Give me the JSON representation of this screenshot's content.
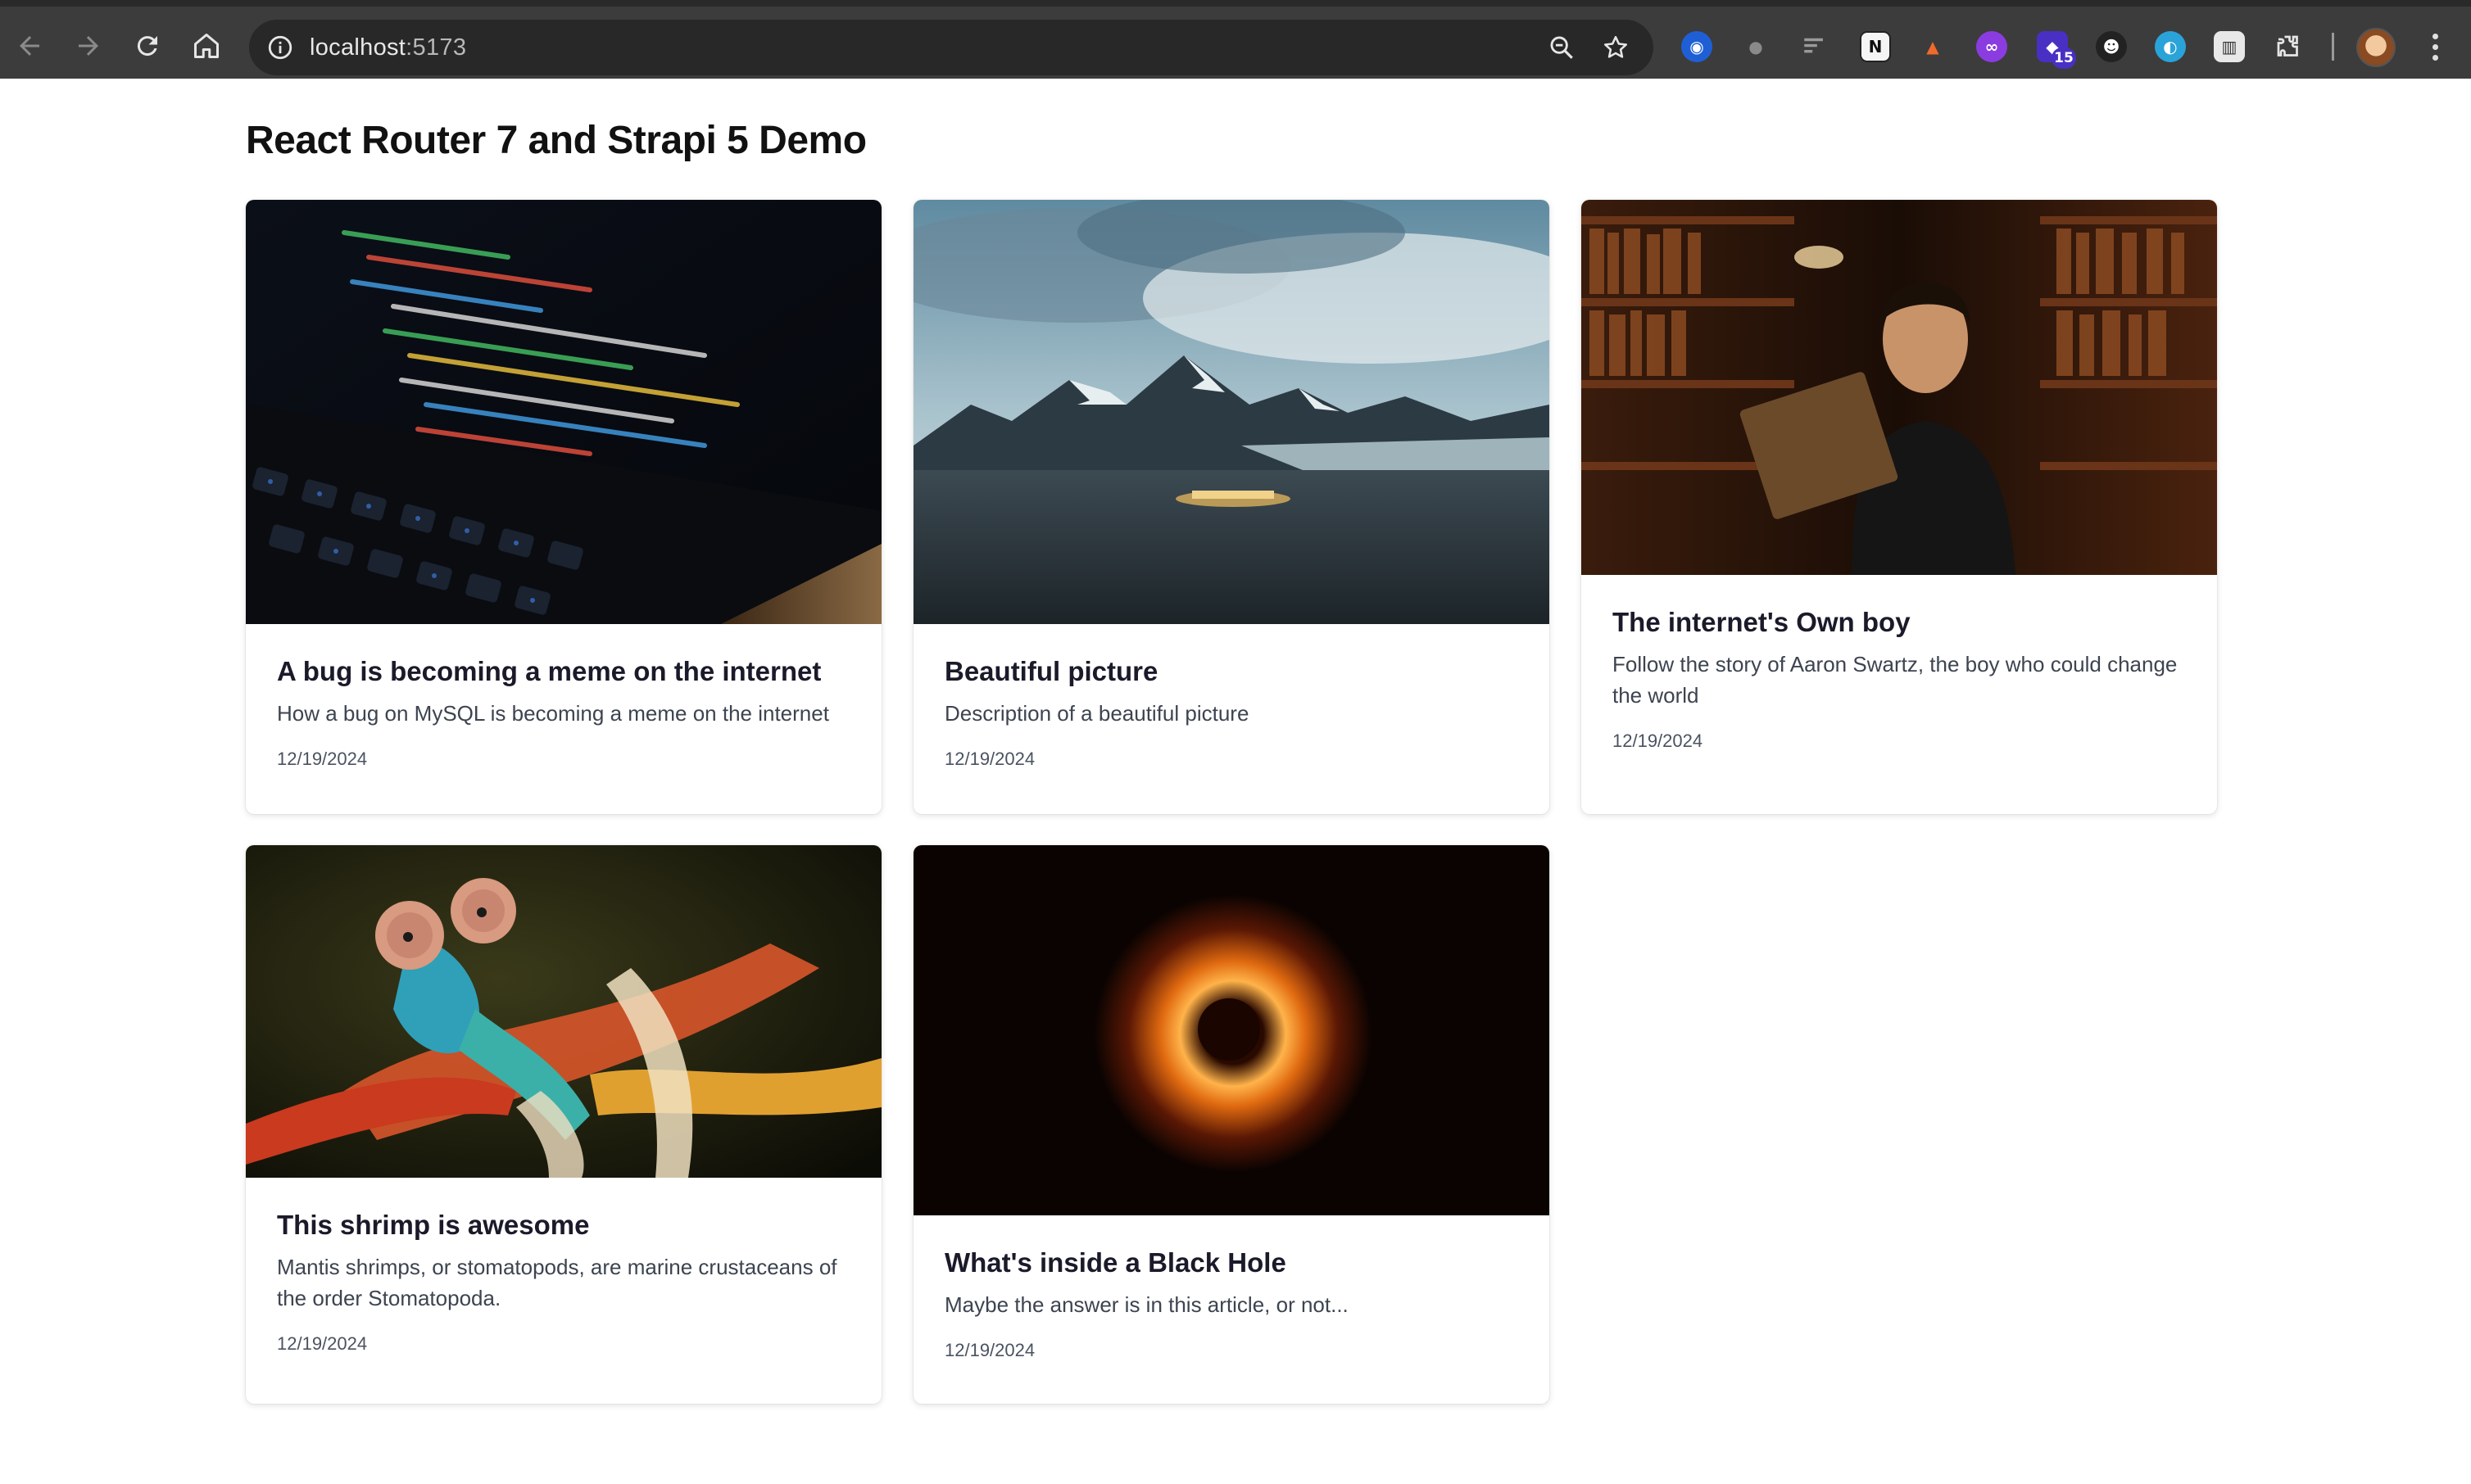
{
  "browser": {
    "url_host": "localhost",
    "url_port": ":5173",
    "extension_badge": "15",
    "icons": [
      "back-arrow-icon",
      "forward-arrow-icon",
      "reload-icon",
      "home-icon",
      "site-info-icon",
      "zoom-icon",
      "bookmark-star-icon",
      "extensions-puzzle-icon",
      "profile-avatar",
      "chrome-menu-icon"
    ]
  },
  "page": {
    "title": "React Router 7 and Strapi 5 Demo"
  },
  "articles": [
    {
      "title": "A bug is becoming a meme on the internet",
      "description": "How a bug on MySQL is becoming a meme on the internet",
      "date": "12/19/2024",
      "image": "laptop-code-photo"
    },
    {
      "title": "Beautiful picture",
      "description": "Description of a beautiful picture",
      "date": "12/19/2024",
      "image": "mountain-landscape-photo"
    },
    {
      "title": "The internet's Own boy",
      "description": "Follow the story of Aaron Swartz, the boy who could change the world",
      "date": "12/19/2024",
      "image": "library-portrait-photo"
    },
    {
      "title": "This shrimp is awesome",
      "description": "Mantis shrimps, or stomatopods, are marine crustaceans of the order Stomatopoda.",
      "date": "12/19/2024",
      "image": "mantis-shrimp-photo"
    },
    {
      "title": "What's inside a Black Hole",
      "description": "Maybe the answer is in this article, or not...",
      "date": "12/19/2024",
      "image": "black-hole-photo"
    }
  ],
  "colors": {
    "chrome_bg": "#3c3c3c",
    "omnibox_bg": "#282828",
    "title_text": "#111111",
    "card_title": "#1a1a2a"
  }
}
